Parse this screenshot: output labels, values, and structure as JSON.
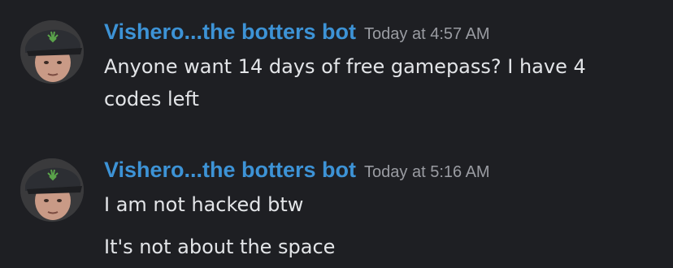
{
  "messages": [
    {
      "avatar_icon": "user-avatar-cap-icon",
      "username": "Vishero...the botters bot",
      "timestamp": "Today at 4:57 AM",
      "lines": [
        "Anyone want 14 days of free gamepass? I have 4 codes left"
      ]
    },
    {
      "avatar_icon": "user-avatar-cap-icon",
      "username": "Vishero...the botters bot",
      "timestamp": "Today at 5:16 AM",
      "lines": [
        "I am not hacked btw",
        "It's not about the space"
      ]
    }
  ],
  "colors": {
    "background": "#1e1f23",
    "username": "#3d93d6",
    "timestamp": "#9a9ca2",
    "text": "#e3e5e8"
  }
}
